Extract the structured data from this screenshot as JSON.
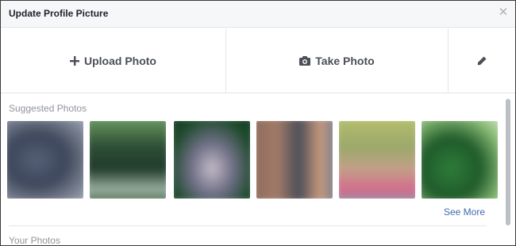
{
  "dialog": {
    "title": "Update Profile Picture",
    "close_icon": "close-icon"
  },
  "actions": {
    "upload_label": "Upload Photo",
    "upload_icon": "plus-icon",
    "take_label": "Take Photo",
    "take_icon": "camera-icon",
    "edit_icon": "pencil-icon"
  },
  "suggested": {
    "title": "Suggested Photos",
    "see_more": "See More",
    "photos": [
      {
        "name": "suggested-photo-1"
      },
      {
        "name": "suggested-photo-2"
      },
      {
        "name": "suggested-photo-3"
      },
      {
        "name": "suggested-photo-4"
      },
      {
        "name": "suggested-photo-5"
      },
      {
        "name": "suggested-photo-6"
      }
    ]
  },
  "your_photos": {
    "title": "Your Photos"
  },
  "colors": {
    "accent": "#4267b2",
    "header_bg": "#f6f7f9",
    "text_muted": "#90949c"
  }
}
